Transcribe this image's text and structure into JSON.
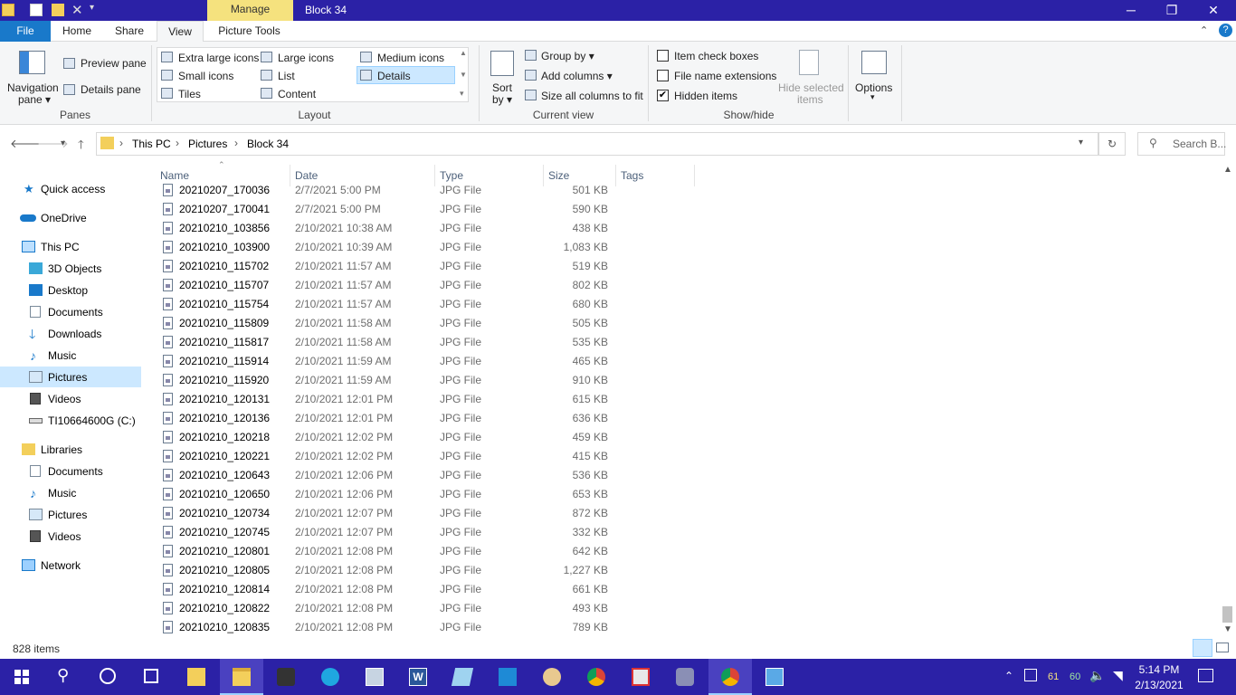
{
  "window": {
    "manage_tab": "Manage",
    "title": "Block 34",
    "minimize": "─",
    "restore": "❐",
    "close": "✕"
  },
  "ribbon_tabs": [
    "File",
    "Home",
    "Share",
    "View",
    "Picture Tools"
  ],
  "ribbon": {
    "panes": {
      "nav_pane_label": "Navigation",
      "nav_pane_label2": "pane ▾",
      "preview_pane": "Preview pane",
      "details_pane": "Details pane",
      "group_label": "Panes"
    },
    "layout": {
      "options": [
        "Extra large icons",
        "Large icons",
        "Medium icons",
        "Small icons",
        "List",
        "Details",
        "Tiles",
        "Content"
      ],
      "selected": "Details",
      "group_label": "Layout"
    },
    "current_view": {
      "sort_by": "Sort",
      "sort_by2": "by ▾",
      "group_by": "Group by ▾",
      "add_columns": "Add columns ▾",
      "size_all": "Size all columns to fit",
      "group_label": "Current view"
    },
    "show_hide": {
      "item_check_boxes": "Item check boxes",
      "file_name_extensions": "File name extensions",
      "hidden_items": "Hidden items",
      "hide_selected": "Hide selected",
      "hide_selected2": "items",
      "group_label": "Show/hide",
      "item_check_boxes_checked": false,
      "file_name_extensions_checked": false,
      "hidden_items_checked": true
    },
    "options": {
      "label": "Options",
      "arrow": "▾"
    }
  },
  "address": {
    "path": [
      "This PC",
      "Pictures",
      "Block 34"
    ],
    "search_placeholder": "Search B..."
  },
  "nav": {
    "quick_access": "Quick access",
    "onedrive": "OneDrive",
    "this_pc": "This PC",
    "pc_items": [
      "3D Objects",
      "Desktop",
      "Documents",
      "Downloads",
      "Music",
      "Pictures",
      "Videos",
      "TI10664600G (C:)"
    ],
    "libraries": "Libraries",
    "lib_items": [
      "Documents",
      "Music",
      "Pictures",
      "Videos"
    ],
    "network": "Network"
  },
  "columns": {
    "name": "Name",
    "date": "Date",
    "type": "Type",
    "size": "Size",
    "tags": "Tags"
  },
  "files": [
    {
      "name": "20210207_170036",
      "date": "2/7/2021 5:00 PM",
      "type": "JPG File",
      "size": "501 KB"
    },
    {
      "name": "20210207_170041",
      "date": "2/7/2021 5:00 PM",
      "type": "JPG File",
      "size": "590 KB"
    },
    {
      "name": "20210210_103856",
      "date": "2/10/2021 10:38 AM",
      "type": "JPG File",
      "size": "438 KB"
    },
    {
      "name": "20210210_103900",
      "date": "2/10/2021 10:39 AM",
      "type": "JPG File",
      "size": "1,083 KB"
    },
    {
      "name": "20210210_115702",
      "date": "2/10/2021 11:57 AM",
      "type": "JPG File",
      "size": "519 KB"
    },
    {
      "name": "20210210_115707",
      "date": "2/10/2021 11:57 AM",
      "type": "JPG File",
      "size": "802 KB"
    },
    {
      "name": "20210210_115754",
      "date": "2/10/2021 11:57 AM",
      "type": "JPG File",
      "size": "680 KB"
    },
    {
      "name": "20210210_115809",
      "date": "2/10/2021 11:58 AM",
      "type": "JPG File",
      "size": "505 KB"
    },
    {
      "name": "20210210_115817",
      "date": "2/10/2021 11:58 AM",
      "type": "JPG File",
      "size": "535 KB"
    },
    {
      "name": "20210210_115914",
      "date": "2/10/2021 11:59 AM",
      "type": "JPG File",
      "size": "465 KB"
    },
    {
      "name": "20210210_115920",
      "date": "2/10/2021 11:59 AM",
      "type": "JPG File",
      "size": "910 KB"
    },
    {
      "name": "20210210_120131",
      "date": "2/10/2021 12:01 PM",
      "type": "JPG File",
      "size": "615 KB"
    },
    {
      "name": "20210210_120136",
      "date": "2/10/2021 12:01 PM",
      "type": "JPG File",
      "size": "636 KB"
    },
    {
      "name": "20210210_120218",
      "date": "2/10/2021 12:02 PM",
      "type": "JPG File",
      "size": "459 KB"
    },
    {
      "name": "20210210_120221",
      "date": "2/10/2021 12:02 PM",
      "type": "JPG File",
      "size": "415 KB"
    },
    {
      "name": "20210210_120643",
      "date": "2/10/2021 12:06 PM",
      "type": "JPG File",
      "size": "536 KB"
    },
    {
      "name": "20210210_120650",
      "date": "2/10/2021 12:06 PM",
      "type": "JPG File",
      "size": "653 KB"
    },
    {
      "name": "20210210_120734",
      "date": "2/10/2021 12:07 PM",
      "type": "JPG File",
      "size": "872 KB"
    },
    {
      "name": "20210210_120745",
      "date": "2/10/2021 12:07 PM",
      "type": "JPG File",
      "size": "332 KB"
    },
    {
      "name": "20210210_120801",
      "date": "2/10/2021 12:08 PM",
      "type": "JPG File",
      "size": "642 KB"
    },
    {
      "name": "20210210_120805",
      "date": "2/10/2021 12:08 PM",
      "type": "JPG File",
      "size": "1,227 KB"
    },
    {
      "name": "20210210_120814",
      "date": "2/10/2021 12:08 PM",
      "type": "JPG File",
      "size": "661 KB"
    },
    {
      "name": "20210210_120822",
      "date": "2/10/2021 12:08 PM",
      "type": "JPG File",
      "size": "493 KB"
    },
    {
      "name": "20210210_120835",
      "date": "2/10/2021 12:08 PM",
      "type": "JPG File",
      "size": "789 KB"
    }
  ],
  "status": {
    "item_count": "828 items"
  },
  "taskbar": {
    "apps": [
      "start-icon",
      "search-icon",
      "cortana-icon",
      "task-view-icon",
      "file-manager-icon",
      "file-explorer-icon",
      "game-icon",
      "edge-icon",
      "photos-icon",
      "word-icon",
      "app-icon",
      "photos-viewer-icon",
      "paint-icon",
      "chrome-icon",
      "tool-icon",
      "notification-app-icon",
      "chrome-icon-2",
      "control-panel-icon"
    ],
    "tray_61": "61",
    "tray_60": "60",
    "time": "5:14 PM",
    "date": "2/13/2021"
  },
  "colors": {
    "titlebar": "#2b21a6",
    "file_tab": "#1979ca",
    "manage_tab": "#f5e27e",
    "selected_nav": "#cce8ff"
  }
}
